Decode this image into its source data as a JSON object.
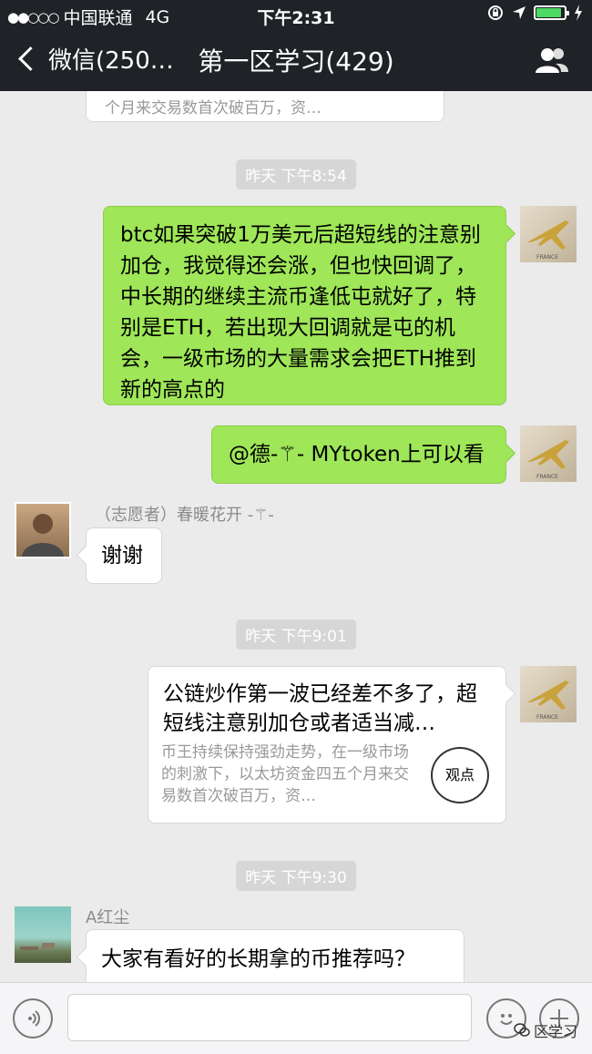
{
  "status": {
    "signal": "●●○○○",
    "carrier": "中国联通",
    "network": "4G",
    "time": "下午2:31",
    "battery_level": 0.9
  },
  "nav": {
    "back_label": "微信(250…",
    "title": "第一区学习(429)",
    "right_icon": "group-members-icon"
  },
  "messages": {
    "prev_card_desc_tail": "个月来交易数首次破百万，资…",
    "time1": "昨天 下午8:54",
    "m1_text": "btc如果突破1万美元后超短线的注意别加仓，我觉得还会涨，但也快回调了，中长期的继续主流币逢低屯就好了，特别是ETH，若出现大回调就是屯的机会，一级市场的大量需求会把ETH推到新的高点的",
    "m2_text": "@德-⚚- MYtoken上可以看",
    "m3_sender": "（志愿者）春暖花开 -⚚-",
    "m3_text": "谢谢",
    "time2": "昨天 下午9:01",
    "card_title": "公链炒作第一波已经差不多了，超短线注意别加仓或者适当减…",
    "card_desc": "币王持续保持强劲走势，在一级市场的刺激下，以太坊资金四五个月来交易数首次破百万，资…",
    "card_badge": "观点",
    "time3": "昨天 下午9:30",
    "m5_sender": "A红尘",
    "m5_text": "大家有看好的长期拿的币推荐吗？",
    "avatar_label": "FRANCE"
  },
  "input": {
    "voice_icon": "voice-icon",
    "emoji_icon": "emoji-icon",
    "plus_icon": "plus-icon",
    "watermark": "区学习"
  },
  "colors": {
    "bar": "#1f2226",
    "background": "#ebebeb",
    "green_bubble": "#9fe658",
    "battery": "#4cd964"
  }
}
